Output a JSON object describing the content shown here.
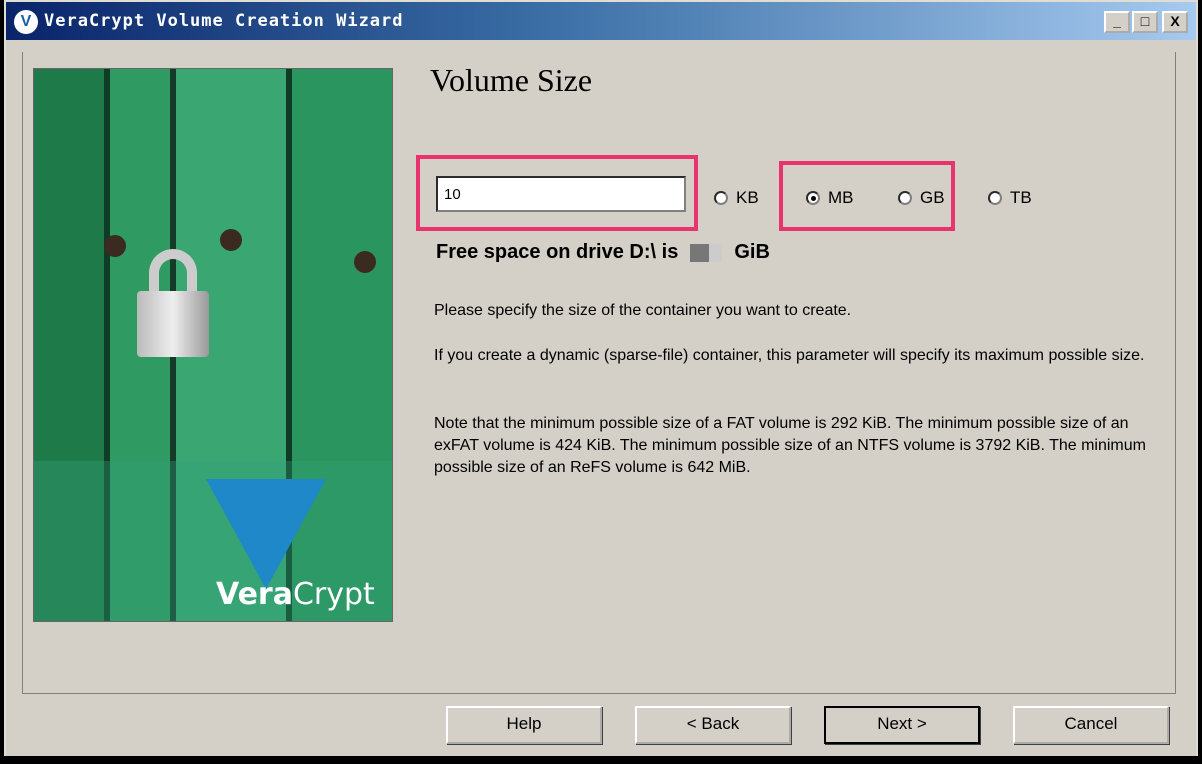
{
  "window": {
    "title": "VeraCrypt Volume Creation Wizard",
    "controls": [
      "_",
      "□",
      "X"
    ]
  },
  "image": {
    "logo_bold": "Vera",
    "logo_regular": "Crypt"
  },
  "page": {
    "heading": "Volume Size",
    "size_input_value": "10",
    "units": [
      {
        "label": "KB",
        "selected": false
      },
      {
        "label": "MB",
        "selected": true
      },
      {
        "label": "GB",
        "selected": false
      },
      {
        "label": "TB",
        "selected": false
      }
    ],
    "free_space_prefix": "Free space on drive D:\\ is",
    "free_space_unit": "GiB",
    "para1": "Please specify the size of the container you want to create.",
    "para2": "If you create a dynamic (sparse-file) container, this parameter will specify its maximum possible size.",
    "para3": "Note that the minimum possible size of a FAT volume is 292 KiB. The minimum possible size of an exFAT volume is 424 KiB. The minimum possible size of an NTFS volume is 3792 KiB. The minimum possible size of an ReFS volume is 642 MiB."
  },
  "buttons": {
    "help": "Help",
    "back": "< Back",
    "next": "Next >",
    "cancel": "Cancel"
  },
  "colors": {
    "highlight": "#e8336e",
    "titlebar": "#0a246a",
    "dialog_bg": "#d4d0c8"
  }
}
